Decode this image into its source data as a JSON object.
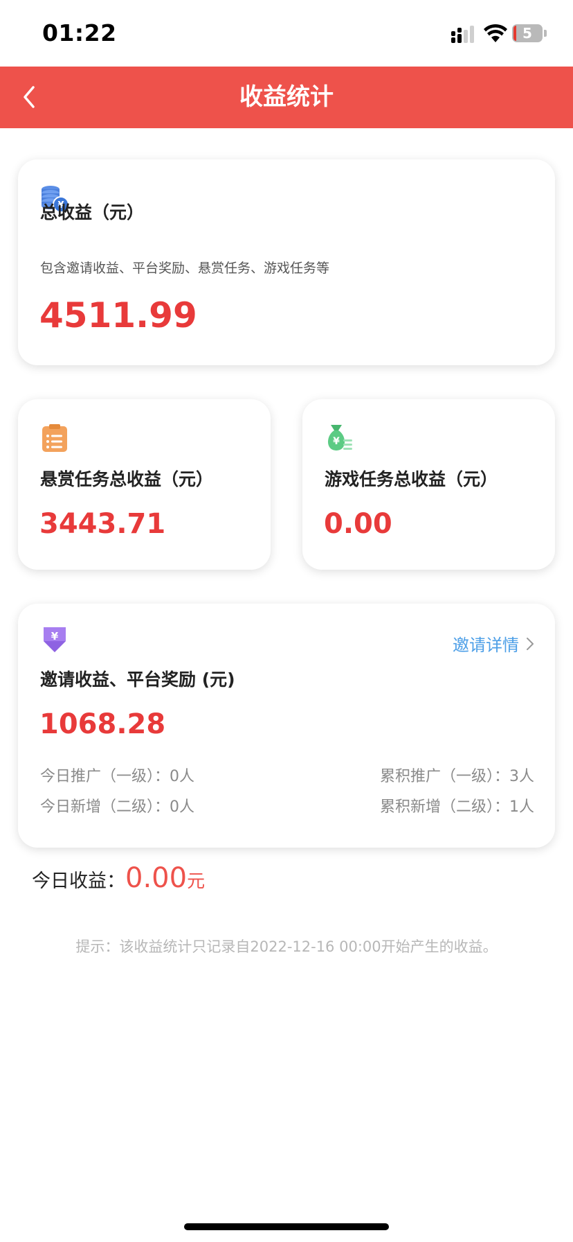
{
  "status_bar": {
    "time": "01:22",
    "battery": "5"
  },
  "nav": {
    "title": "收益统计"
  },
  "total": {
    "label": "总收益（元）",
    "desc": "包含邀请收益、平台奖励、悬赏任务、游戏任务等",
    "value": "4511.99"
  },
  "bounty": {
    "label": "悬赏任务总收益（元）",
    "value": "3443.71"
  },
  "game": {
    "label": "游戏任务总收益（元）",
    "value": "0.00"
  },
  "invite": {
    "label": "邀请收益、平台奖励 (元)",
    "link": "邀请详情",
    "value": "1068.28",
    "stats": {
      "today_promote": "今日推广（一级）：0人",
      "total_promote": "累积推广（一级）：3人",
      "today_new": "今日新增（二级）：0人",
      "total_new": "累积新增（二级）：1人"
    }
  },
  "today": {
    "label": "今日收益：",
    "value": "0.00",
    "unit": "元"
  },
  "hint": "提示：该收益统计只记录自2022-12-16 00:00开始产生的收益。",
  "colors": {
    "nav": "#ee524b",
    "value": "#e83a3a",
    "link": "#4b9ee7"
  },
  "icons": [
    "back-arrow-icon",
    "coins-icon",
    "clipboard-icon",
    "money-bag-icon",
    "yen-download-icon",
    "chevron-right-icon"
  ]
}
